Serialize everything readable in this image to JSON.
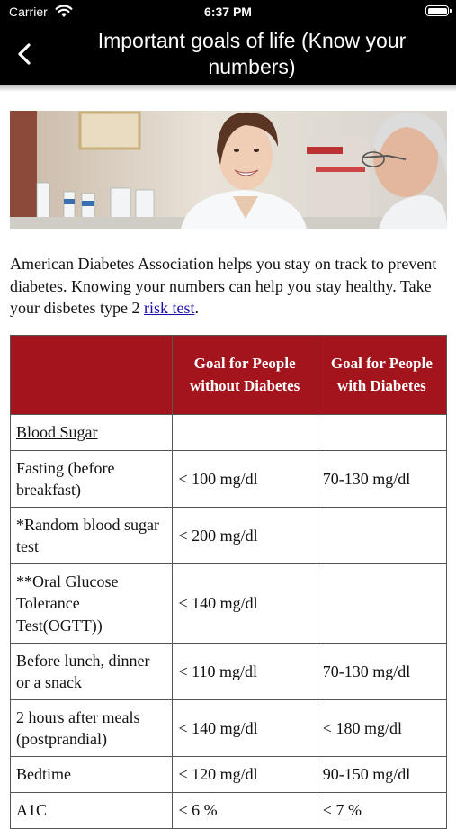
{
  "status_bar": {
    "carrier": "Carrier",
    "time": "6:37 PM"
  },
  "nav": {
    "title": "Important goals of life (Know your numbers)"
  },
  "intro": {
    "text": "American Diabetes Association helps you stay on track to prevent diabetes. Knowing your numbers can help you stay healthy. Take your disbetes type 2 ",
    "link_text": "risk test",
    "after_link": "."
  },
  "table": {
    "headers": [
      "",
      "Goal for People without Diabetes",
      "Goal for People with Diabetes"
    ],
    "rows": [
      {
        "label": "Blood Sugar",
        "without": "",
        "with": ""
      },
      {
        "label": "Fasting (before breakfast)",
        "without": "< 100 mg/dl",
        "with": "70-130 mg/dl"
      },
      {
        "label": "*Random blood sugar test",
        "without": "< 200 mg/dl",
        "with": ""
      },
      {
        "label": "**Oral Glucose Tolerance Test(OGTT))",
        "without": "< 140 mg/dl",
        "with": ""
      },
      {
        "label": "Before lunch, dinner or a snack",
        "without": "< 110 mg/dl",
        "with": "70-130 mg/dl"
      },
      {
        "label": "2 hours after meals (postprandial)",
        "without": "< 140 mg/dl",
        "with": "< 180 mg/dl"
      },
      {
        "label": "Bedtime",
        "without": "< 120 mg/dl",
        "with": "90-150 mg/dl"
      },
      {
        "label": "A1C",
        "without": "< 6 %",
        "with": "< 7 %"
      }
    ]
  },
  "colors": {
    "header_bg": "#000000",
    "table_header_bg": "#a3141c",
    "link": "#1a0dab"
  },
  "icons": {
    "back": "chevron-left-icon",
    "wifi": "wifi-icon",
    "battery": "battery-icon"
  }
}
